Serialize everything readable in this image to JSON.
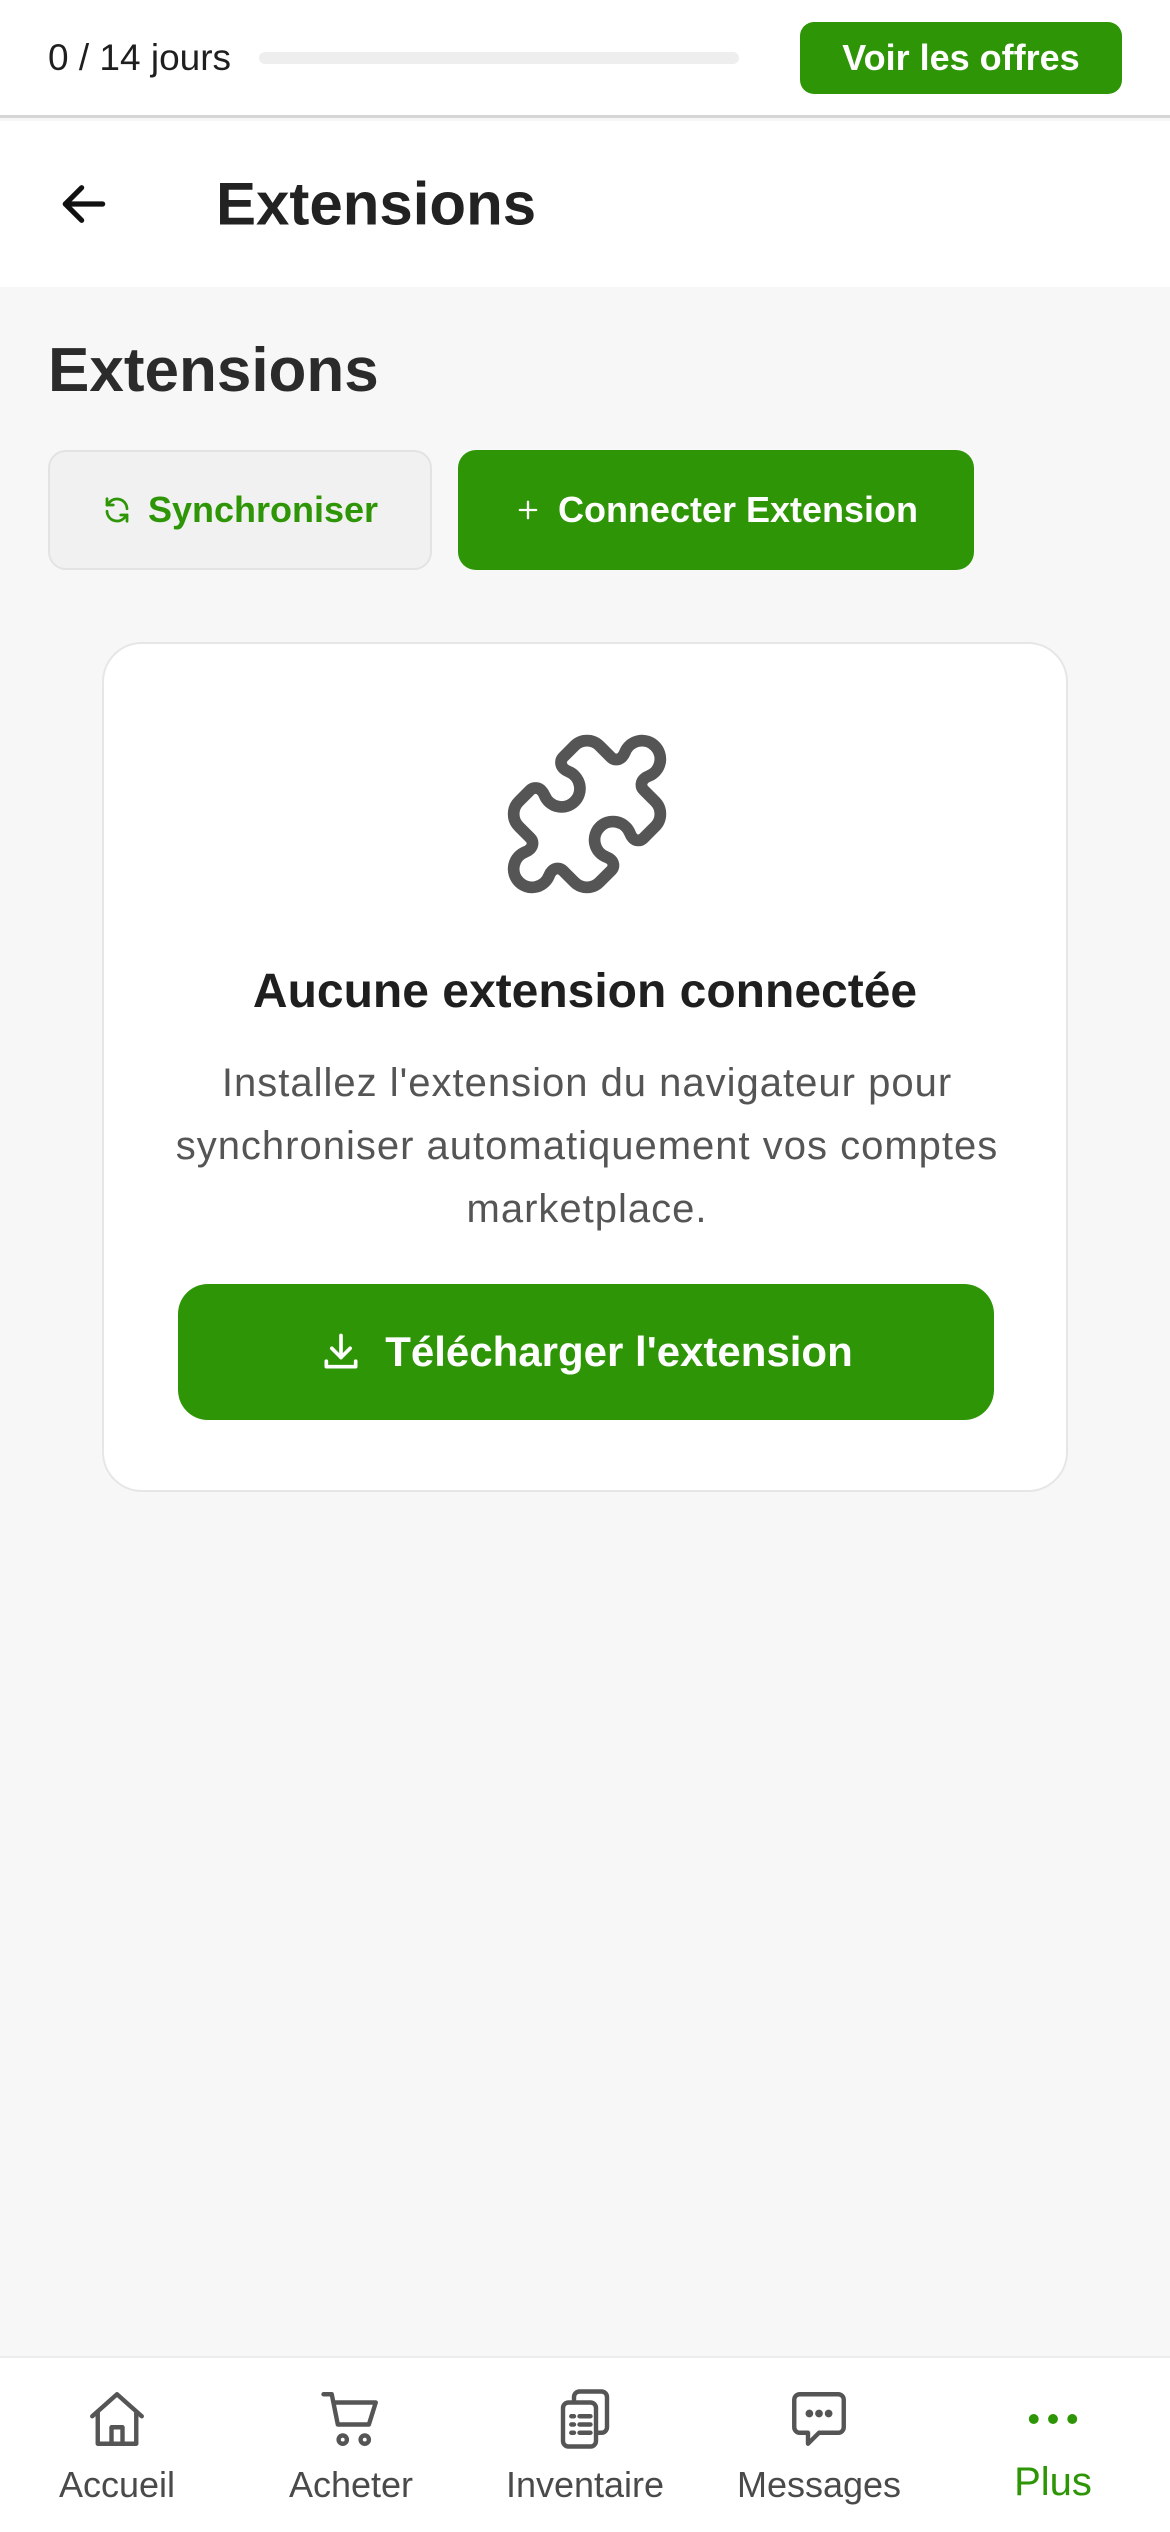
{
  "trial": {
    "days_text": "0 / 14 jours",
    "progress_fraction": 0,
    "offers_label": "Voir les offres"
  },
  "header": {
    "back_icon": "arrow-left-icon",
    "title": "Extensions"
  },
  "main": {
    "section_title": "Extensions",
    "sync_label": "Synchroniser",
    "connect_label": "Connecter Extension",
    "empty": {
      "icon": "puzzle-icon",
      "title": "Aucune extension connectée",
      "description": "Installez l'extension du navigateur pour synchroniser automatiquement vos comptes marketplace.",
      "download_label": "Télécharger l'extension"
    }
  },
  "bottom_nav": {
    "items": [
      {
        "label": "Accueil",
        "icon": "home-icon"
      },
      {
        "label": "Acheter",
        "icon": "cart-icon"
      },
      {
        "label": "Inventaire",
        "icon": "clipboard-icon"
      },
      {
        "label": "Messages",
        "icon": "chat-icon"
      },
      {
        "label": "Plus",
        "icon": "more-dots-icon",
        "active": true
      }
    ]
  },
  "colors": {
    "accent": "#2e9606",
    "background": "#f7f7f7",
    "card": "#ffffff"
  }
}
